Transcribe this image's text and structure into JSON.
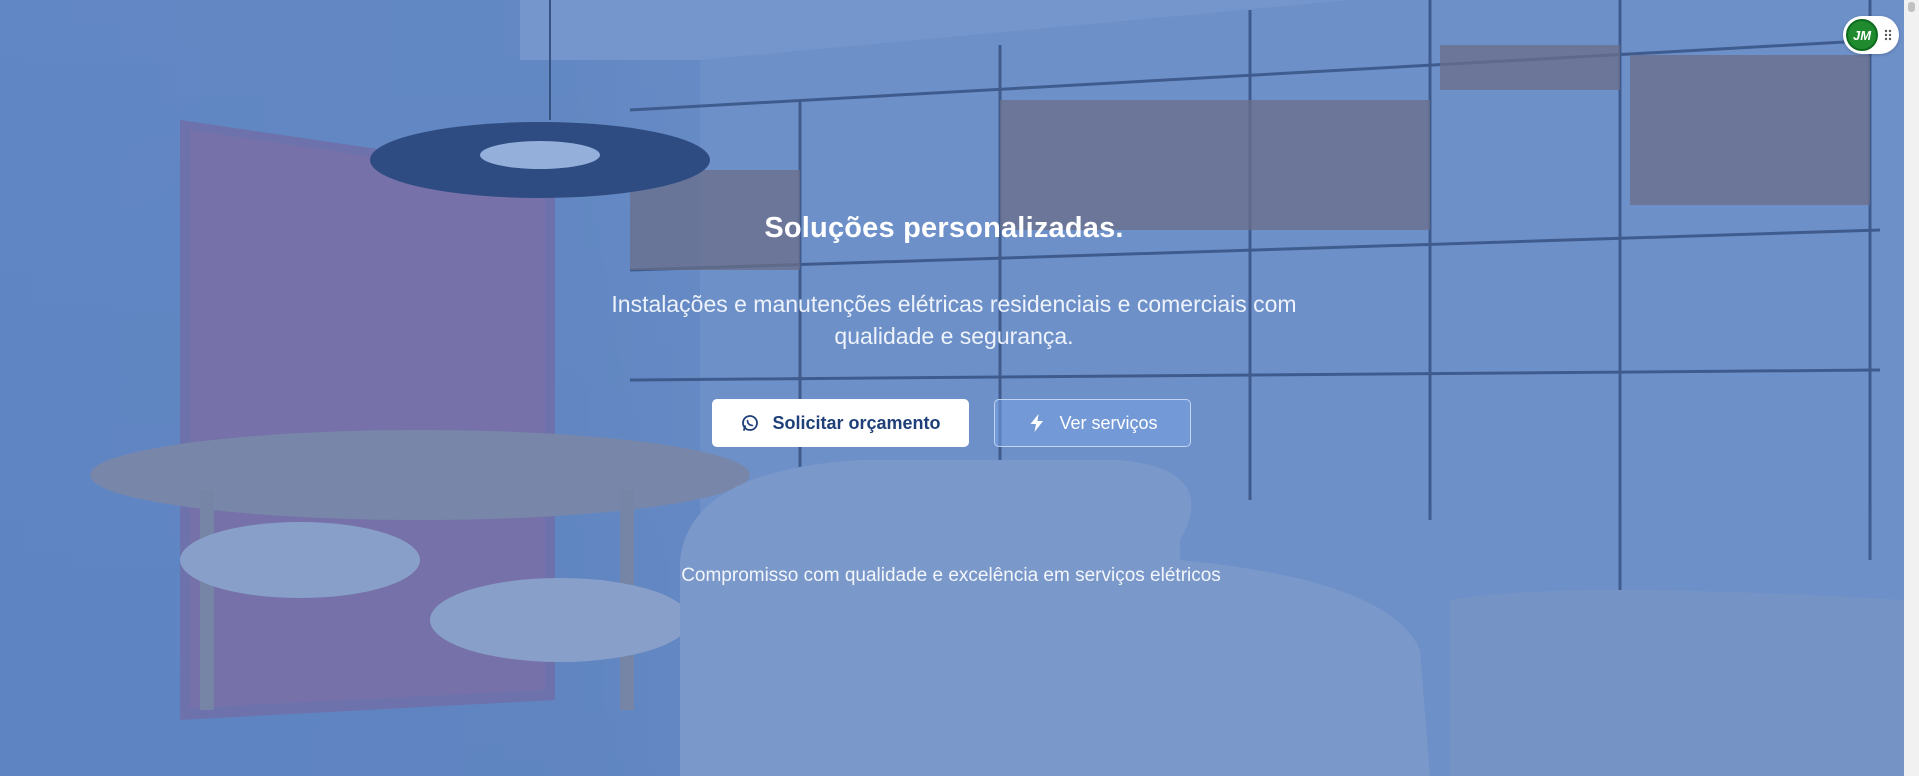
{
  "hero": {
    "title": "Soluções personalizadas.",
    "subtitle": "Instalações e manutenções elétricas residenciais e comerciais com qualidade e segurança.",
    "primary_button": {
      "label": "Solicitar orçamento",
      "icon": "whatsapp-icon"
    },
    "secondary_button": {
      "label": "Ver serviços",
      "icon": "lightning-icon"
    },
    "tagline": "Compromisso com qualidade e excelência em serviços elétricos"
  },
  "badge": {
    "logo_text": "JM",
    "icon": "grip-dots-icon"
  },
  "colors": {
    "overlay": "#4c78be",
    "primary_button_bg": "#ffffff",
    "primary_button_text": "#1f3f78",
    "logo_green": "#1f8a2e"
  }
}
